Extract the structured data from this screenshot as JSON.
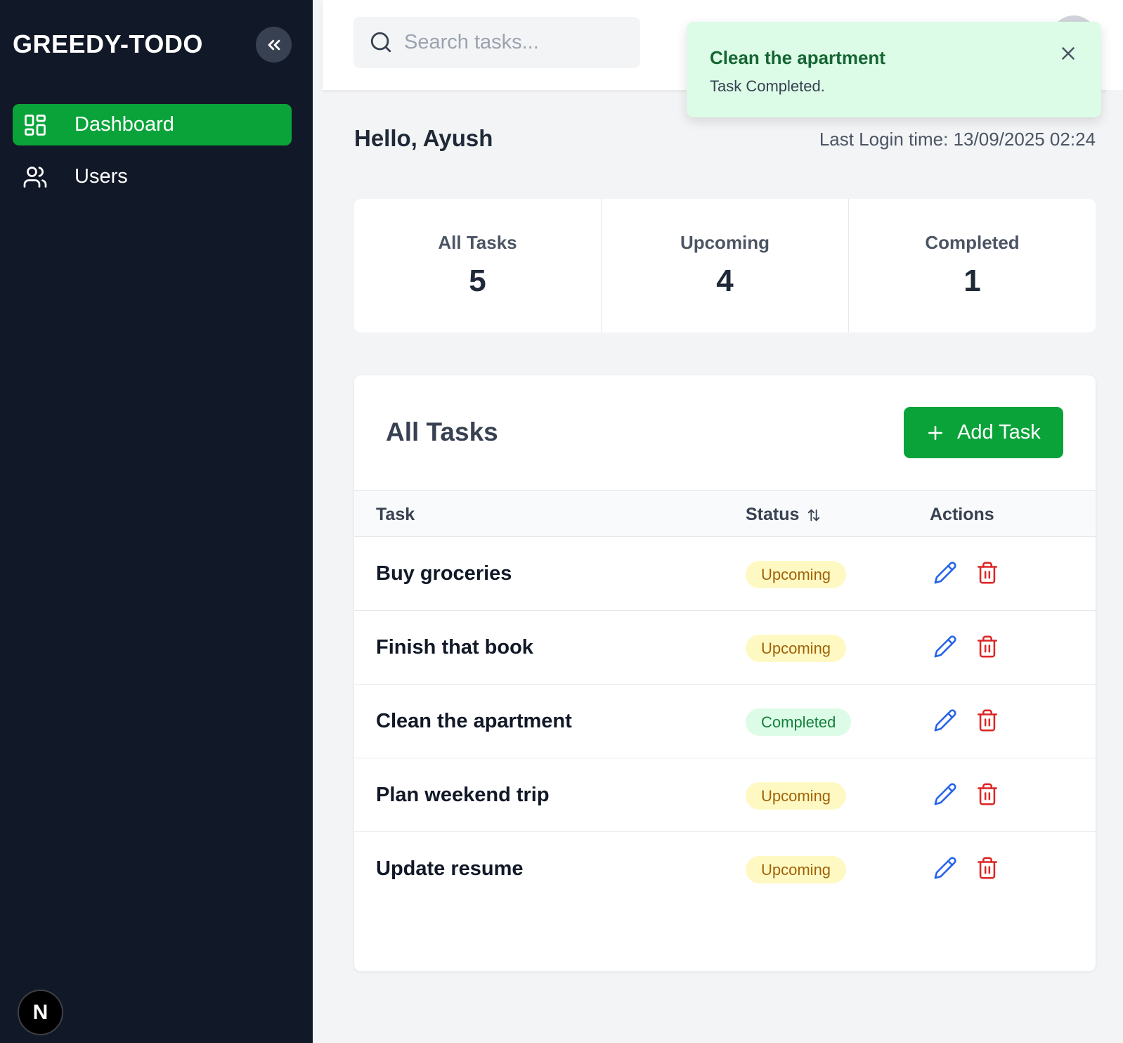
{
  "app": {
    "brand": "GREEDY-TODO",
    "badge_letter": "N"
  },
  "sidebar": {
    "items": [
      {
        "label": "Dashboard",
        "icon": "dashboard-icon",
        "active": true
      },
      {
        "label": "Users",
        "icon": "users-icon",
        "active": false
      }
    ]
  },
  "search": {
    "placeholder": "Search tasks..."
  },
  "toast": {
    "title": "Clean the apartment",
    "message": "Task Completed."
  },
  "greeting": "Hello, Ayush",
  "last_login": "Last Login time: 13/09/2025 02:24",
  "stats": [
    {
      "label": "All Tasks",
      "value": "5"
    },
    {
      "label": "Upcoming",
      "value": "4"
    },
    {
      "label": "Completed",
      "value": "1"
    }
  ],
  "tasks_card": {
    "title": "All Tasks",
    "add_label": "Add Task",
    "columns": {
      "task": "Task",
      "status": "Status",
      "actions": "Actions"
    },
    "rows": [
      {
        "name": "Buy groceries",
        "status": "Upcoming"
      },
      {
        "name": "Finish that book",
        "status": "Upcoming"
      },
      {
        "name": "Clean the apartment",
        "status": "Completed"
      },
      {
        "name": "Plan weekend trip",
        "status": "Upcoming"
      },
      {
        "name": "Update resume",
        "status": "Upcoming"
      }
    ]
  },
  "colors": {
    "sidebar_bg": "#111827",
    "accent_green": "#0aa33a",
    "upcoming_bg": "#fef9c3",
    "upcoming_text": "#a16207",
    "completed_bg": "#dcfce7",
    "completed_text": "#15803d",
    "edit_blue": "#2563eb",
    "delete_red": "#dc2626"
  }
}
